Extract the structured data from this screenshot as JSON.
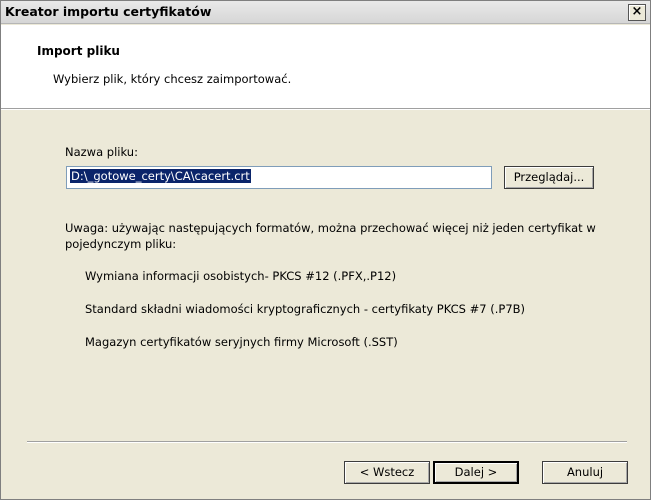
{
  "window": {
    "title": "Kreator importu certyfikatów",
    "close_glyph": "×"
  },
  "header": {
    "title": "Import pliku",
    "subtitle": "Wybierz plik, który chcesz zaimportować."
  },
  "file": {
    "label": "Nazwa pliku:",
    "value": "D:\\_gotowe_certy\\CA\\cacert.crt",
    "browse_label": "Przeglądaj..."
  },
  "note": {
    "text": "Uwaga: używając następujących formatów, można przechować więcej niż jeden certyfikat w pojedynczym pliku:",
    "formats": [
      "Wymiana informacji osobistych- PKCS #12 (.PFX,.P12)",
      "Standard składni wiadomości kryptograficznych - certyfikaty PKCS #7 (.P7B)",
      "Magazyn certyfikatów seryjnych firmy Microsoft (.SST)"
    ]
  },
  "buttons": {
    "back": "< Wstecz",
    "next": "Dalej >",
    "cancel": "Anuluj"
  }
}
